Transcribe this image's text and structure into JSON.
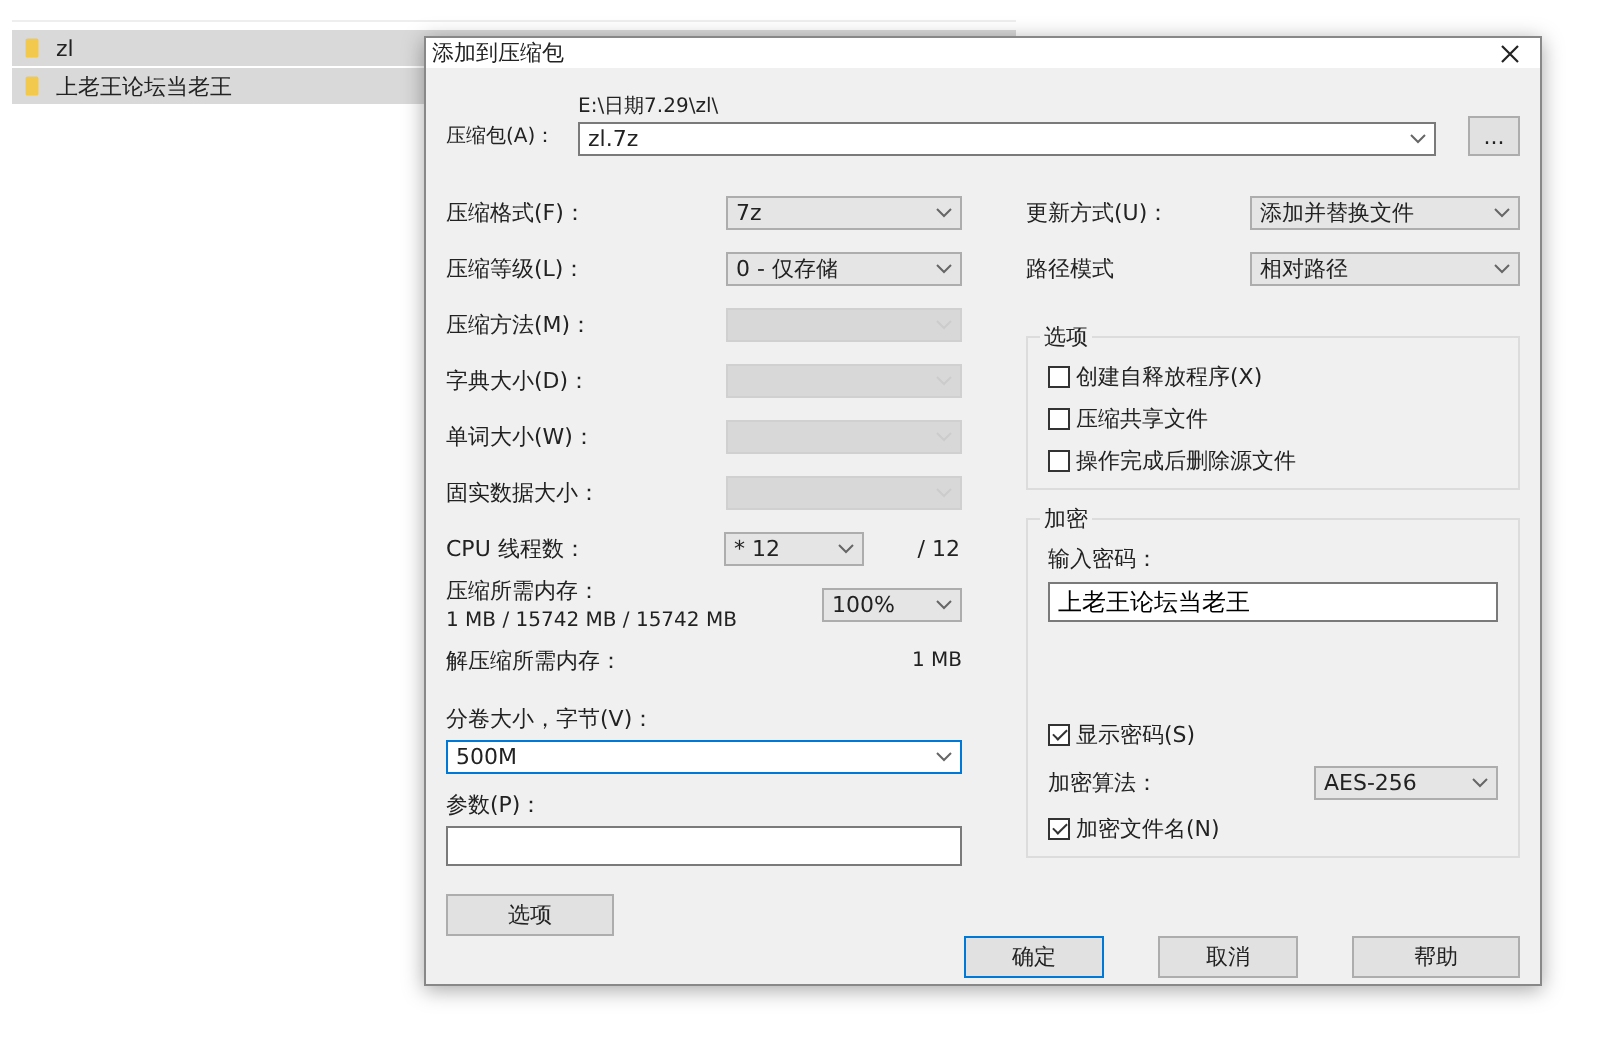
{
  "explorer": {
    "files": [
      {
        "name": "zl",
        "selected": true
      },
      {
        "name": "上老王论坛当老王",
        "selected": true
      }
    ]
  },
  "dialog": {
    "title": "添加到压缩包",
    "archive": {
      "label": "压缩包(A)：",
      "path": "E:\\日期7.29\\zl\\",
      "value": "zl.7z",
      "browse": "..."
    },
    "left_rows": [
      {
        "kind": "select",
        "label": "压缩格式(F)：",
        "value": "7z",
        "disabled": false
      },
      {
        "kind": "select",
        "label": "压缩等级(L)：",
        "value": "0 - 仅存储",
        "disabled": false
      },
      {
        "kind": "select",
        "label": "压缩方法(M)：",
        "disabled": true
      },
      {
        "kind": "select",
        "label": "字典大小(D)：",
        "disabled": true
      },
      {
        "kind": "select",
        "label": "单词大小(W)：",
        "disabled": true
      },
      {
        "kind": "select",
        "label": "固实数据大小：",
        "disabled": true
      },
      {
        "kind": "cpu",
        "label": "CPU 线程数：",
        "value": "* 12",
        "suffix": "/ 12"
      },
      {
        "kind": "memory",
        "label": "压缩所需内存：",
        "detail": "1 MB / 15742 MB / 15742 MB",
        "value": "100%"
      },
      {
        "kind": "info",
        "label": "解压缩所需内存：",
        "value": "1 MB"
      }
    ],
    "volume": {
      "label": "分卷大小，字节(V)：",
      "value": "500M"
    },
    "params": {
      "label": "参数(P)："
    },
    "options_button": "选项",
    "right_rows": [
      {
        "label": "更新方式(U)：",
        "value": "添加并替换文件"
      },
      {
        "label": "路径模式",
        "value": "相对路径"
      }
    ],
    "options_group": {
      "title": "选项",
      "checks": [
        {
          "label": "创建自释放程序(X)",
          "checked": false
        },
        {
          "label": "压缩共享文件",
          "checked": false
        },
        {
          "label": "操作完成后删除源文件",
          "checked": false
        }
      ]
    },
    "encryption": {
      "title": "加密",
      "password_label": "输入密码：",
      "password": "上老王论坛当老王",
      "show_password": {
        "label": "显示密码(S)",
        "checked": true
      },
      "method_label": "加密算法：",
      "method": "AES-256",
      "encrypt_names": {
        "label": "加密文件名(N)",
        "checked": true
      }
    },
    "buttons": [
      {
        "label": "确定",
        "default": true
      },
      {
        "label": "取消",
        "default": false
      },
      {
        "label": "帮助",
        "default": false
      }
    ]
  }
}
